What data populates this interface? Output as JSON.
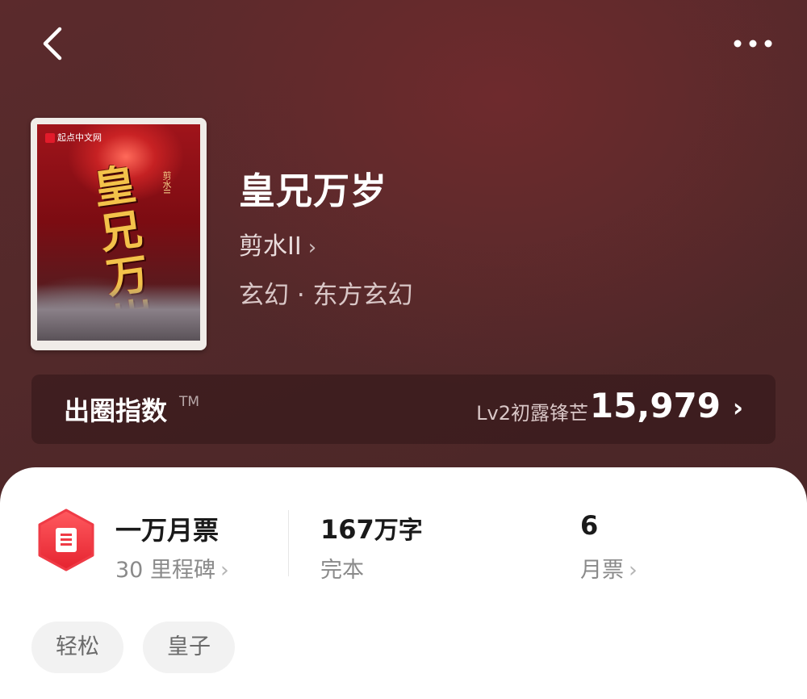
{
  "nav": {
    "back_icon": "chevron-left-icon",
    "more_icon": "more-dots-icon"
  },
  "book": {
    "title": "皇兄万岁",
    "author": "剪水II",
    "genre": "玄幻 · 东方玄幻",
    "cover": {
      "publisher_logo": "起点中文网",
      "title_art": "皇兄万岁",
      "author_art": "剪水II"
    }
  },
  "index": {
    "label": "出圈指数",
    "tm": "TM",
    "level": "Lv2初露锋芒",
    "score": "15,979"
  },
  "stats": [
    {
      "main": "一万月票",
      "sub": "30 里程碑"
    },
    {
      "main_num": "167",
      "main_unit": "万字",
      "sub": "完本"
    },
    {
      "main": "6",
      "sub": "月票"
    }
  ],
  "tags": [
    "轻松",
    "皇子"
  ],
  "colors": {
    "hero_bg": "#52292a",
    "badge_red": "#ef3b46",
    "text_primary": "#1a1a1a",
    "text_secondary": "#8a8a8a"
  }
}
